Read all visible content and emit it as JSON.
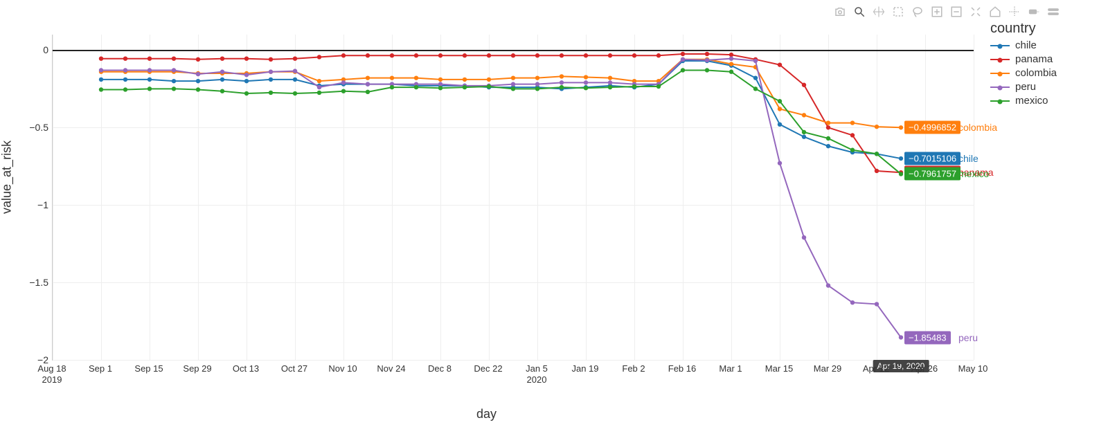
{
  "axes": {
    "ylabel": "value_at_risk",
    "xlabel": "day",
    "yticks": [
      0,
      -0.5,
      -1,
      -1.5,
      -2
    ],
    "ytick_labels": [
      "0",
      "−0.5",
      "−1",
      "−1.5",
      "−2"
    ],
    "xticks_idx": [
      0,
      1,
      2,
      3,
      4,
      5,
      6,
      7,
      8,
      9,
      10,
      11,
      12,
      13,
      14,
      15,
      16,
      17,
      18,
      19
    ],
    "xtick_labels": [
      "Aug 18\n2019",
      "Sep 1",
      "Sep 15",
      "Sep 29",
      "Oct 13",
      "Oct 27",
      "Nov 10",
      "Nov 24",
      "Dec 8",
      "Dec 22",
      "Jan 5\n2020",
      "Jan 19",
      "Feb 2",
      "Feb 16",
      "Mar 1",
      "Mar 15",
      "Mar 29",
      "Apr 12",
      "Apr 26",
      "May 10"
    ]
  },
  "legend": {
    "title": "country",
    "items": [
      {
        "key": "chile",
        "label": "chile",
        "color": "#1f77b4"
      },
      {
        "key": "panama",
        "label": "panama",
        "color": "#d62728"
      },
      {
        "key": "colombia",
        "label": "colombia",
        "color": "#ff7f0e"
      },
      {
        "key": "peru",
        "label": "peru",
        "color": "#9467bd"
      },
      {
        "key": "mexico",
        "label": "mexico",
        "color": "#2ca02c"
      }
    ]
  },
  "hover_marker": {
    "label": "Apr 19, 2020",
    "x_index": 17.5
  },
  "end_labels": [
    {
      "key": "colombia",
      "value_text": "−0.4996852",
      "name": "colombia"
    },
    {
      "key": "chile",
      "value_text": "−0.7015106",
      "name": "chile"
    },
    {
      "key": "panama",
      "value_text": "−0.7932851",
      "name": "panama"
    },
    {
      "key": "mexico",
      "value_text": "−0.7961757",
      "name": "mexico"
    },
    {
      "key": "peru",
      "value_text": "−1.85483",
      "name": "peru"
    }
  ],
  "toolbar": {
    "items": [
      "camera",
      "zoom",
      "pan",
      "box-select",
      "lasso",
      "zoom-in",
      "zoom-out",
      "autoscale",
      "home",
      "spike",
      "hover-closest",
      "hover-compare"
    ],
    "active": "zoom"
  },
  "chart_data": {
    "type": "line",
    "xlabel": "day",
    "ylabel": "value_at_risk",
    "ylim": [
      -2,
      0.1
    ],
    "x_start": "2019-08-18",
    "x_step_days": 7,
    "x": [
      0,
      1,
      2,
      3,
      4,
      5,
      6,
      7,
      8,
      9,
      10,
      11,
      12,
      13,
      14,
      15,
      16,
      17,
      18,
      19,
      20,
      21,
      22,
      23,
      24,
      25,
      26,
      27,
      28,
      29,
      30,
      31,
      32,
      33,
      34,
      35
    ],
    "series": [
      {
        "name": "chile",
        "color": "#1f77b4",
        "values": [
          null,
          null,
          -0.19,
          -0.19,
          -0.19,
          -0.2,
          -0.2,
          -0.19,
          -0.2,
          -0.19,
          -0.19,
          -0.23,
          -0.22,
          -0.22,
          -0.22,
          -0.23,
          -0.23,
          -0.23,
          -0.24,
          -0.24,
          -0.24,
          -0.25,
          -0.24,
          -0.23,
          -0.24,
          -0.22,
          -0.07,
          -0.07,
          -0.1,
          -0.18,
          -0.48,
          -0.56,
          -0.62,
          -0.66,
          -0.67,
          -0.7
        ]
      },
      {
        "name": "panama",
        "color": "#d62728",
        "values": [
          null,
          null,
          -0.055,
          -0.055,
          -0.055,
          -0.055,
          -0.06,
          -0.055,
          -0.055,
          -0.06,
          -0.055,
          -0.045,
          -0.035,
          -0.035,
          -0.035,
          -0.035,
          -0.035,
          -0.035,
          -0.035,
          -0.035,
          -0.035,
          -0.035,
          -0.035,
          -0.035,
          -0.035,
          -0.035,
          -0.025,
          -0.025,
          -0.03,
          -0.06,
          -0.095,
          -0.225,
          -0.5,
          -0.55,
          -0.78,
          -0.79
        ]
      },
      {
        "name": "colombia",
        "color": "#ff7f0e",
        "values": [
          null,
          null,
          -0.14,
          -0.14,
          -0.14,
          -0.14,
          -0.15,
          -0.15,
          -0.15,
          -0.14,
          -0.14,
          -0.2,
          -0.19,
          -0.18,
          -0.18,
          -0.18,
          -0.19,
          -0.19,
          -0.19,
          -0.18,
          -0.18,
          -0.17,
          -0.175,
          -0.18,
          -0.2,
          -0.2,
          -0.06,
          -0.06,
          -0.09,
          -0.11,
          -0.38,
          -0.42,
          -0.47,
          -0.47,
          -0.495,
          -0.5
        ]
      },
      {
        "name": "peru",
        "color": "#9467bd",
        "values": [
          null,
          null,
          -0.13,
          -0.13,
          -0.13,
          -0.13,
          -0.155,
          -0.14,
          -0.16,
          -0.14,
          -0.135,
          -0.24,
          -0.21,
          -0.22,
          -0.22,
          -0.22,
          -0.22,
          -0.23,
          -0.23,
          -0.22,
          -0.22,
          -0.21,
          -0.21,
          -0.21,
          -0.22,
          -0.22,
          -0.06,
          -0.065,
          -0.055,
          -0.07,
          -0.73,
          -1.21,
          -1.52,
          -1.63,
          -1.64,
          -1.855
        ]
      },
      {
        "name": "mexico",
        "color": "#2ca02c",
        "values": [
          null,
          null,
          -0.255,
          -0.255,
          -0.25,
          -0.25,
          -0.255,
          -0.265,
          -0.28,
          -0.275,
          -0.28,
          -0.275,
          -0.265,
          -0.27,
          -0.24,
          -0.24,
          -0.245,
          -0.24,
          -0.235,
          -0.25,
          -0.25,
          -0.24,
          -0.245,
          -0.24,
          -0.235,
          -0.235,
          -0.13,
          -0.13,
          -0.14,
          -0.25,
          -0.33,
          -0.53,
          -0.57,
          -0.645,
          -0.67,
          -0.8
        ]
      }
    ]
  }
}
